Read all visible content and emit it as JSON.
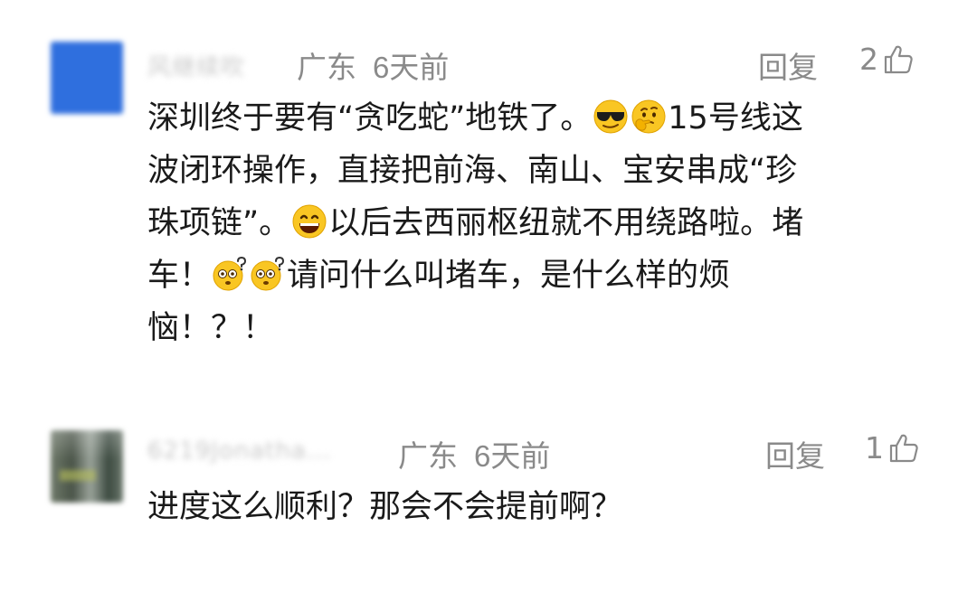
{
  "comments": [
    {
      "username": "风继续吹",
      "region": "广东",
      "time": "6天前",
      "reply_label": "回复",
      "likes": "2",
      "body_lines": [
        [
          "深圳终于要有“贪吃蛇”地铁了。",
          "emoji:sunglasses",
          "emoji:thinking",
          "15号线这"
        ],
        [
          "波闭环操作，直接把前海、南山、宝安串成“珍"
        ],
        [
          "珠项链”。",
          "emoji:grin",
          "以后去西丽枢纽就不用绕路啦。堵"
        ],
        [
          "车！",
          "emoji:confused",
          "emoji:confused",
          "请问什么叫堵车，是什么样的烦"
        ],
        [
          "恼！？！"
        ]
      ]
    },
    {
      "username": "6219Jonatha...",
      "region": "广东",
      "time": "6天前",
      "reply_label": "回复",
      "likes": "1",
      "body_lines": [
        [
          "进度这么顺利？那会不会提前啊？"
        ]
      ]
    }
  ],
  "colors": {
    "text": "#1a1a1a",
    "meta": "#8a8a8a",
    "avatar_blue": "#2f6fde"
  },
  "icons": {
    "like": "thumbs-up-icon",
    "emoji_sunglasses": "sunglasses-emoji-icon",
    "emoji_thinking": "thinking-emoji-icon",
    "emoji_grin": "grin-emoji-icon",
    "emoji_confused": "confused-emoji-icon"
  }
}
